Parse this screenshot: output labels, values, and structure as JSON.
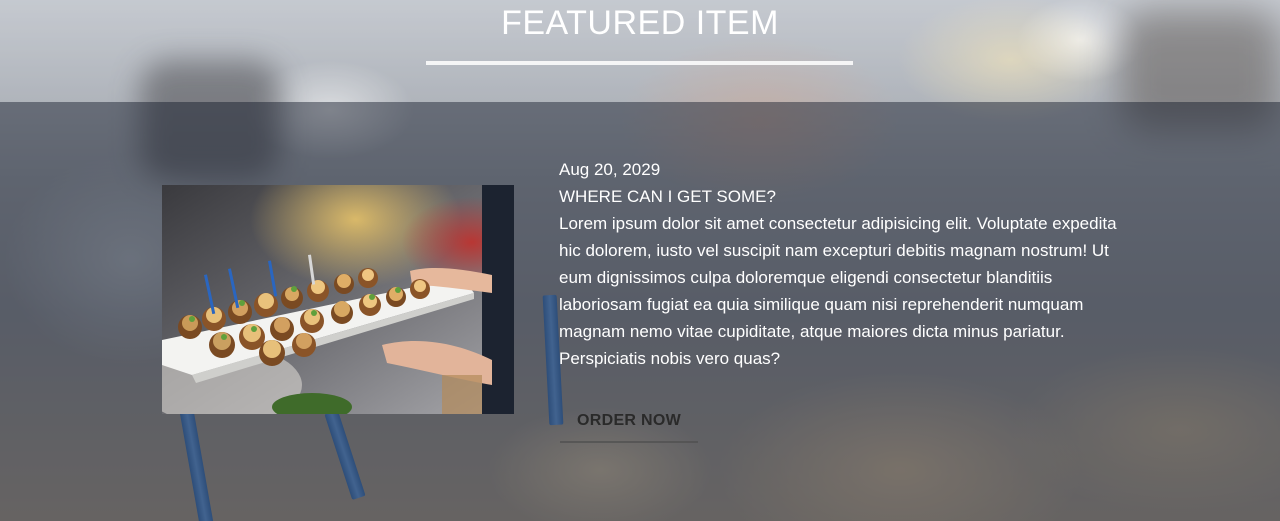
{
  "section": {
    "title": "FEATURED ITEM"
  },
  "featured": {
    "date": "Aug 20, 2029",
    "heading": "WHERE CAN I GET SOME?",
    "body": "Lorem ipsum dolor sit amet consectetur adipisicing elit. Voluptate expedita hic dolorem, iusto vel suscipit nam excepturi debitis magnam nostrum! Ut eum dignissimos culpa doloremque eligendi consectetur blanditiis laboriosam fugiat ea quia similique quam nisi reprehenderit numquam magnam nemo vitae cupiditate, atque maiores dicta minus pariatur. Perspiciatis nobis vero quas?",
    "button_label": "ORDER NOW"
  },
  "colors": {
    "text": "#ffffff",
    "button_text": "#2a2a2a",
    "overlay": "#3a404c"
  }
}
